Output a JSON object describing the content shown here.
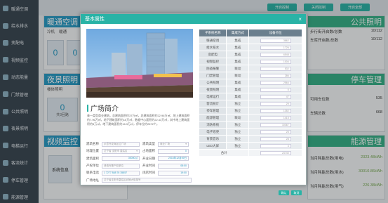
{
  "sidebar": {
    "items": [
      {
        "label": "暖通空调"
      },
      {
        "label": "给水排水"
      },
      {
        "label": "变配电"
      },
      {
        "label": "视频监控"
      },
      {
        "label": "动态能量"
      },
      {
        "label": "门禁管理"
      },
      {
        "label": "公共照明"
      },
      {
        "label": "夜景照明"
      },
      {
        "label": "电梯运行"
      },
      {
        "label": "客流统计"
      },
      {
        "label": "停车管理"
      },
      {
        "label": "能源管理"
      }
    ]
  },
  "toolbar": {
    "buttons": [
      {
        "label": "开启控制"
      },
      {
        "label": "关闭控制"
      },
      {
        "label": "开启全部"
      }
    ]
  },
  "background": {
    "hvac_title": "暖通空调",
    "hvac_sub": [
      "冷机",
      "暖通"
    ],
    "hvac_tiles": [
      "0",
      "0"
    ],
    "night_title": "夜景照明",
    "night_sub": "楼体照明",
    "night_tile_value": "0",
    "night_tile_label": "共3回路",
    "video_title": "视频监控",
    "video_sys": "系统信息",
    "public_title": "公共照明",
    "public_rows": [
      {
        "label": "步行街开启数/总数",
        "value": "10/112"
      },
      {
        "label": "车库开启数/总数",
        "value": "10/112"
      }
    ],
    "parking_title": "停车管理",
    "parking_sys": "系统信息",
    "parking_rows": [
      {
        "label": "可用车位数",
        "value": "535"
      },
      {
        "label": "车辆总数",
        "value": "668"
      }
    ],
    "energy_title": "能源管理",
    "energy_rows": [
      {
        "label": "当月耗能总数(用电)",
        "value": "2323.48kWh"
      },
      {
        "label": "当月耗能总数(用水)",
        "value": "30010.86kWh"
      },
      {
        "label": "当月耗能总数(用气)",
        "value": "226.38kWh"
      }
    ]
  },
  "modal": {
    "title": "基本属性",
    "close": "×",
    "section_title": "广场简介",
    "intro": "青一类型商业建筑，总建筑面积约37万㎡，总建筑面积约22.96万㎡，地上建筑面积约7.96万㎡，地下建筑面积约15万㎡，数据中心面积约22.43万㎡，其中地上建筑面积约5万㎡，地下建筑面积约16.3万㎡，停车位约2672个。",
    "form": {
      "name": {
        "label": "建筑名称",
        "placeholder": "示意开发商区位广场",
        "label2": "建筑类型",
        "value2": "商业广场"
      },
      "location": {
        "label": "地理位置",
        "value": "辽宁省 沈阳市 皇姑区",
        "label2": "占地面积",
        "value2": "0"
      },
      "build": {
        "label": "建筑面积",
        "value": "30000㎡",
        "label2": "开业日期",
        "value2": "2015年12月09日"
      },
      "owner": {
        "label": "产权单位",
        "placeholder": "请填写基产权单位",
        "label2": "开业时间",
        "value2": "08:00"
      },
      "contact": {
        "label": "联系电话",
        "value": "1 7277 888 76 35857",
        "label2": "闭店时间",
        "value2": "19:00"
      },
      "desc": {
        "label": "广场地址",
        "placeholder": "辽宁省沈阳市皇姑区北陵大街某号"
      }
    },
    "table": {
      "headers": [
        "子系统名称",
        "集成方式",
        "设备点位"
      ],
      "rows": [
        {
          "name": "暖通空调",
          "mode": "集成",
          "count": "3862"
        },
        {
          "name": "给水排水",
          "mode": "集成",
          "count": "1726"
        },
        {
          "name": "变配电",
          "mode": "集成",
          "count": "6548"
        },
        {
          "name": "视频监控",
          "mode": "集成",
          "count": "1004"
        },
        {
          "name": "防盗报警",
          "mode": "联动",
          "count": "532"
        },
        {
          "name": "门禁管理",
          "mode": "联动",
          "count": "286"
        },
        {
          "name": "公共照明",
          "mode": "集成",
          "count": "2564"
        },
        {
          "name": "夜景照明",
          "mode": "集成",
          "count": "0"
        },
        {
          "name": "电梯运行",
          "mode": "集成",
          "count": "47"
        },
        {
          "name": "客流统计",
          "mode": "独立",
          "count": "29"
        },
        {
          "name": "停车管理",
          "mode": "独立",
          "count": "1352"
        },
        {
          "name": "能源管理",
          "mode": "联动",
          "count": "1415"
        },
        {
          "name": "消防系统",
          "mode": "独立",
          "count": "10367"
        },
        {
          "name": "电子巡更",
          "mode": "独立",
          "count": "25"
        },
        {
          "name": "背景音乐",
          "mode": "独立",
          "count": "28"
        },
        {
          "name": "LED大屏",
          "mode": "独立",
          "count": "3"
        }
      ],
      "total_label": "合计",
      "total_value": "24740"
    },
    "buttons": {
      "confirm": "确认",
      "cancel": "取消"
    }
  }
}
